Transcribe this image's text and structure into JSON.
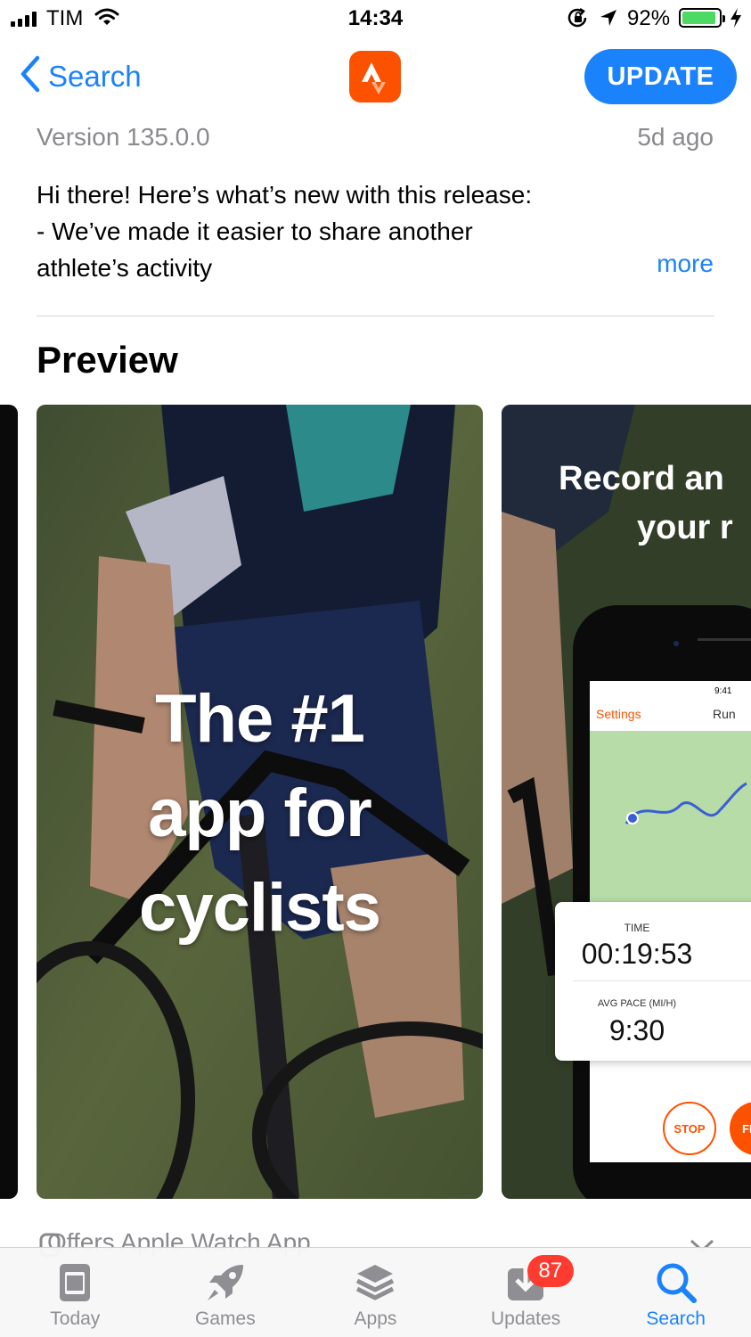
{
  "status_bar": {
    "carrier": "TIM",
    "time": "14:34",
    "battery_percent": "92%",
    "battery_level": 0.92,
    "battery_color": "#4cd964"
  },
  "nav": {
    "back_label": "Search",
    "app_icon": "strava-logo-icon",
    "app_icon_color": "#fc5200",
    "update_label": "UPDATE",
    "accent": "#1a82fb"
  },
  "whats_new": {
    "version": "Version 135.0.0",
    "updated": "5d ago",
    "lines": [
      "Hi there! Here’s what’s new with this release:",
      "- We’ve made it easier to share another",
      "athlete’s activity"
    ],
    "more_label": "more"
  },
  "preview": {
    "title": "Preview",
    "screenshots": [
      {
        "headline_lines": [
          "The #1",
          "app for",
          "cyclists"
        ]
      },
      {
        "headline_lines": [
          "Record an",
          "your r"
        ],
        "phone": {
          "status_time": "9:41",
          "settings_label": "Settings",
          "run_label": "Run",
          "time_label": "TIME",
          "time_value": "00:19:53",
          "pace_label": "AVG PACE (MI/H)",
          "pace_value": "9:30",
          "stop_label": "STOP",
          "finish_label": "FI"
        }
      }
    ]
  },
  "watch_row": {
    "label": "Offers Apple Watch App"
  },
  "tab_bar": {
    "tabs": [
      {
        "label": "Today",
        "icon": "today-icon"
      },
      {
        "label": "Games",
        "icon": "rocket-icon"
      },
      {
        "label": "Apps",
        "icon": "layers-icon"
      },
      {
        "label": "Updates",
        "icon": "download-icon",
        "badge": "87"
      },
      {
        "label": "Search",
        "icon": "search-icon",
        "active": true
      }
    ]
  }
}
